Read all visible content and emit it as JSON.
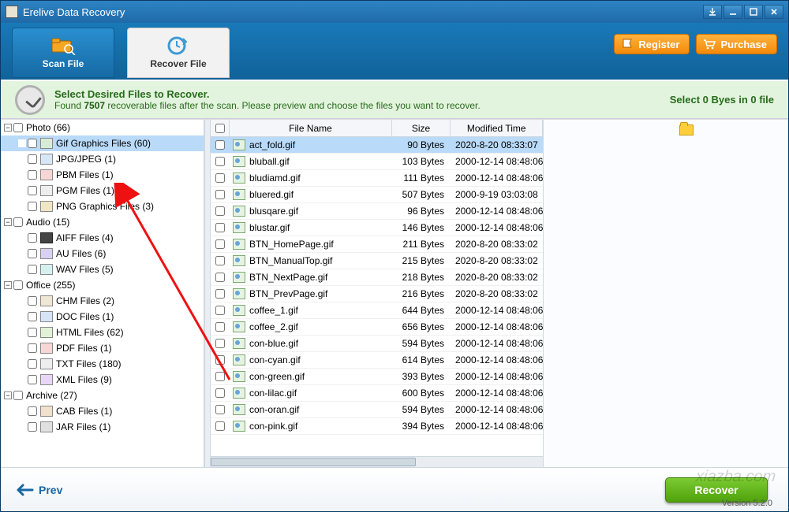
{
  "window": {
    "title": "Erelive Data Recovery",
    "register_label": "Register",
    "purchase_label": "Purchase",
    "version_label": "Version 5.2.0"
  },
  "tabs": {
    "scan_file": "Scan File",
    "recover_file": "Recover File"
  },
  "banner": {
    "headline": "Select Desired Files to Recover.",
    "found_pre": "Found ",
    "found_count": "7507",
    "found_post": " recoverable files after the scan. Please preview and choose the files you want to recover.",
    "selection_status": "Select 0 Byes in 0 file"
  },
  "sidebar": [
    {
      "level": 0,
      "label": "Photo (66)",
      "icon": "",
      "selected": false,
      "col": false
    },
    {
      "level": 1,
      "label": "Gif Graphics Files (60)",
      "icon": "gif",
      "selected": true,
      "col": false
    },
    {
      "level": 1,
      "label": "JPG/JPEG (1)",
      "icon": "jpg",
      "selected": false,
      "col": false
    },
    {
      "level": 1,
      "label": "PBM Files (1)",
      "icon": "pbm",
      "selected": false,
      "col": false
    },
    {
      "level": 1,
      "label": "PGM Files (1)",
      "icon": "pgm",
      "selected": false,
      "col": false
    },
    {
      "level": 1,
      "label": "PNG Graphics Files (3)",
      "icon": "png",
      "selected": false,
      "col": false
    },
    {
      "level": 0,
      "label": "Audio (15)",
      "icon": "",
      "selected": false,
      "col": false
    },
    {
      "level": 1,
      "label": "AIFF Files (4)",
      "icon": "aiff",
      "selected": false,
      "col": false
    },
    {
      "level": 1,
      "label": "AU Files (6)",
      "icon": "au",
      "selected": false,
      "col": false
    },
    {
      "level": 1,
      "label": "WAV Files (5)",
      "icon": "wav",
      "selected": false,
      "col": false
    },
    {
      "level": 0,
      "label": "Office (255)",
      "icon": "",
      "selected": false,
      "col": false
    },
    {
      "level": 1,
      "label": "CHM Files (2)",
      "icon": "chm",
      "selected": false,
      "col": false
    },
    {
      "level": 1,
      "label": "DOC Files (1)",
      "icon": "doc",
      "selected": false,
      "col": false
    },
    {
      "level": 1,
      "label": "HTML Files (62)",
      "icon": "html",
      "selected": false,
      "col": false
    },
    {
      "level": 1,
      "label": "PDF Files (1)",
      "icon": "pdf",
      "selected": false,
      "col": false
    },
    {
      "level": 1,
      "label": "TXT Files (180)",
      "icon": "txt",
      "selected": false,
      "col": false
    },
    {
      "level": 1,
      "label": "XML Files (9)",
      "icon": "xml",
      "selected": false,
      "col": false
    },
    {
      "level": 0,
      "label": "Archive (27)",
      "icon": "",
      "selected": false,
      "col": false
    },
    {
      "level": 1,
      "label": "CAB Files (1)",
      "icon": "cab",
      "selected": false,
      "col": false
    },
    {
      "level": 1,
      "label": "JAR Files (1)",
      "icon": "jar",
      "selected": false,
      "col": false
    }
  ],
  "columns": {
    "name": "File Name",
    "size": "Size",
    "mod": "Modified Time"
  },
  "files": [
    {
      "name": "act_fold.gif",
      "size": "90 Bytes",
      "mod": "2020-8-20 08:33:07",
      "sel": true
    },
    {
      "name": "bluball.gif",
      "size": "103 Bytes",
      "mod": "2000-12-14 08:48:06",
      "sel": false
    },
    {
      "name": "bludiamd.gif",
      "size": "111 Bytes",
      "mod": "2000-12-14 08:48:06",
      "sel": false
    },
    {
      "name": "bluered.gif",
      "size": "507 Bytes",
      "mod": "2000-9-19 03:03:08",
      "sel": false
    },
    {
      "name": "blusqare.gif",
      "size": "96 Bytes",
      "mod": "2000-12-14 08:48:06",
      "sel": false
    },
    {
      "name": "blustar.gif",
      "size": "146 Bytes",
      "mod": "2000-12-14 08:48:06",
      "sel": false
    },
    {
      "name": "BTN_HomePage.gif",
      "size": "211 Bytes",
      "mod": "2020-8-20 08:33:02",
      "sel": false
    },
    {
      "name": "BTN_ManualTop.gif",
      "size": "215 Bytes",
      "mod": "2020-8-20 08:33:02",
      "sel": false
    },
    {
      "name": "BTN_NextPage.gif",
      "size": "218 Bytes",
      "mod": "2020-8-20 08:33:02",
      "sel": false
    },
    {
      "name": "BTN_PrevPage.gif",
      "size": "216 Bytes",
      "mod": "2020-8-20 08:33:02",
      "sel": false
    },
    {
      "name": "coffee_1.gif",
      "size": "644 Bytes",
      "mod": "2000-12-14 08:48:06",
      "sel": false
    },
    {
      "name": "coffee_2.gif",
      "size": "656 Bytes",
      "mod": "2000-12-14 08:48:06",
      "sel": false
    },
    {
      "name": "con-blue.gif",
      "size": "594 Bytes",
      "mod": "2000-12-14 08:48:06",
      "sel": false
    },
    {
      "name": "con-cyan.gif",
      "size": "614 Bytes",
      "mod": "2000-12-14 08:48:06",
      "sel": false
    },
    {
      "name": "con-green.gif",
      "size": "393 Bytes",
      "mod": "2000-12-14 08:48:06",
      "sel": false
    },
    {
      "name": "con-lilac.gif",
      "size": "600 Bytes",
      "mod": "2000-12-14 08:48:06",
      "sel": false
    },
    {
      "name": "con-oran.gif",
      "size": "594 Bytes",
      "mod": "2000-12-14 08:48:06",
      "sel": false
    },
    {
      "name": "con-pink.gif",
      "size": "394 Bytes",
      "mod": "2000-12-14 08:48:06",
      "sel": false
    }
  ],
  "footer": {
    "prev_label": "Prev",
    "recover_label": "Recover"
  }
}
